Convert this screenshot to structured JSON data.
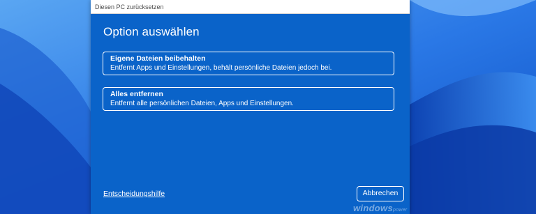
{
  "window": {
    "title": "Diesen PC zurücksetzen"
  },
  "dialog": {
    "heading": "Option auswählen",
    "options": [
      {
        "title": "Eigene Dateien beibehalten",
        "description": "Entfernt Apps und Einstellungen, behält persönliche Dateien jedoch bei."
      },
      {
        "title": "Alles entfernen",
        "description": "Entfernt alle persönlichen Dateien, Apps und Einstellungen."
      }
    ],
    "help_link": "Entscheidungshilfe",
    "cancel_label": "Abbrechen"
  },
  "watermark": {
    "main": "windows",
    "sub": "power"
  },
  "colors": {
    "dialog_bg": "#0a63c9",
    "wallpaper": "#1f63d8",
    "text": "#ffffff"
  }
}
